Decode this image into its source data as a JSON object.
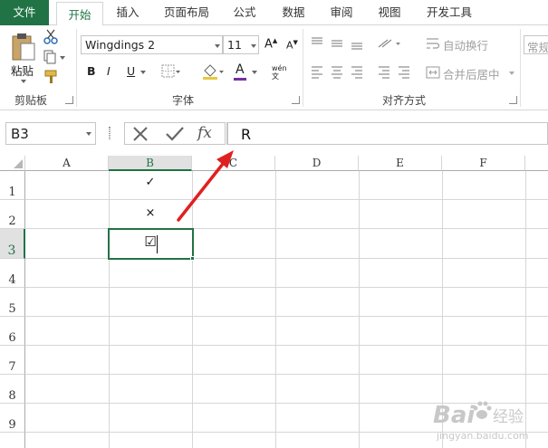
{
  "tabs": [
    {
      "label": "文件",
      "active": false
    },
    {
      "label": "开始",
      "active": true
    },
    {
      "label": "插入",
      "active": false
    },
    {
      "label": "页面布局",
      "active": false
    },
    {
      "label": "公式",
      "active": false
    },
    {
      "label": "数据",
      "active": false
    },
    {
      "label": "审阅",
      "active": false
    },
    {
      "label": "视图",
      "active": false
    },
    {
      "label": "开发工具",
      "active": false
    }
  ],
  "ribbon": {
    "clipboard": {
      "paste_label": "粘贴",
      "group_label": "剪贴板"
    },
    "font": {
      "font_name": "Wingdings 2",
      "font_size": "11",
      "group_label": "字体",
      "bold": "B",
      "italic": "I",
      "underline": "U",
      "grow": "A",
      "shrink": "A",
      "font_color": "A",
      "phonetic": "wén"
    },
    "alignment": {
      "wrap_text": "自动换行",
      "merge_center": "合并后居中",
      "group_label": "对齐方式"
    },
    "number": {
      "format": "常规"
    }
  },
  "formula_bar": {
    "name_box": "B3",
    "fx": "fx",
    "content": "R"
  },
  "grid": {
    "columns": [
      "A",
      "B",
      "C",
      "D",
      "E",
      "F"
    ],
    "rows": [
      "1",
      "2",
      "3",
      "4",
      "5",
      "6",
      "7",
      "8",
      "9"
    ],
    "selected_cell": "B3",
    "cells": {
      "B1": "✓",
      "B2": "×",
      "B3": "☑"
    }
  },
  "colors": {
    "accent": "#217346",
    "arrow": "#e02020",
    "font_color_bar": "#7030a0"
  },
  "watermark": {
    "text": "Bai",
    "sub": "经验",
    "url": "jingyan.baidu.com"
  }
}
